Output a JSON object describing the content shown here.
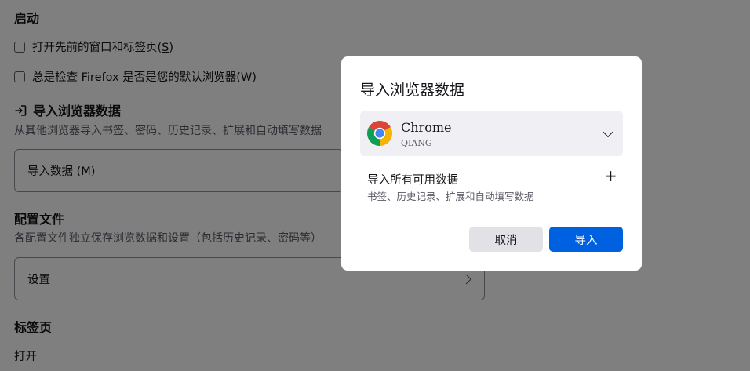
{
  "settings": {
    "startup_title": "启动",
    "restore_label": "打开先前的窗口和标签页",
    "restore_key": "S",
    "default_check_label": "总是检查 Firefox 是否是您的默认浏览器",
    "default_check_key": "W",
    "import_title": "导入浏览器数据",
    "import_desc": "从其他浏览器导入书签、密码、历史记录、扩展和自动填写数据",
    "import_button_label": "导入数据",
    "import_button_key": "M",
    "profiles_title": "配置文件",
    "profiles_desc": "各配置文件独立保存浏览数据和设置（包括历史记录、密码等）",
    "profiles_button_label": "设置",
    "tabs_title": "标签页",
    "tabs_open_label": "打开"
  },
  "dialog": {
    "title": "导入浏览器数据",
    "browser": {
      "name": "Chrome",
      "profile": "QIANG",
      "icon": "chrome-logo"
    },
    "import_all_label": "导入所有可用数据",
    "import_all_desc": "书签、历史记录、扩展和自动填写数据",
    "expand_icon": "plus-icon",
    "cancel_label": "取消",
    "import_label": "导入"
  },
  "colors": {
    "primary": "#0061e0",
    "overlay": "rgba(0,0,0,0.5)",
    "select_bg": "#f0f0f4"
  }
}
